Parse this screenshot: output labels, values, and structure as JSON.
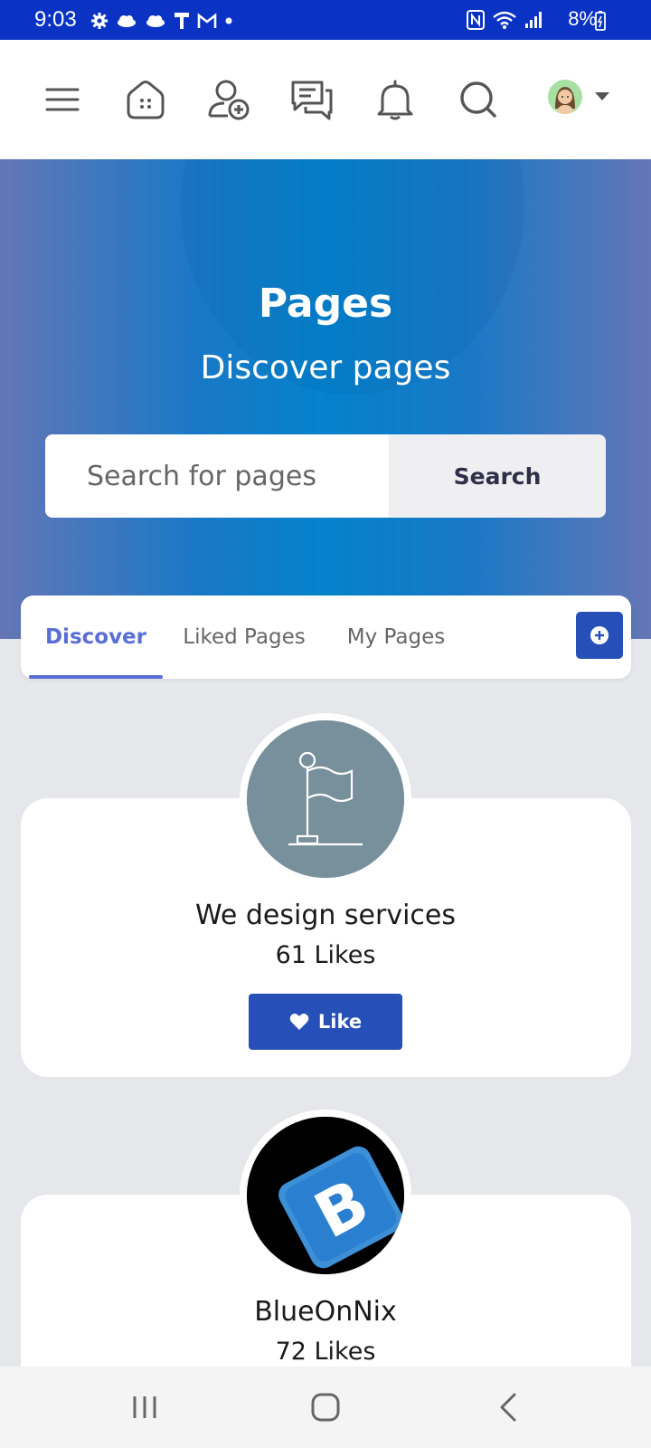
{
  "status_bar": {
    "time": "9:03",
    "battery": "8%",
    "left_icons": [
      "gear-icon",
      "cloud-icon",
      "cloud-icon",
      "hammer-icon",
      "gmail-icon",
      "dot-icon"
    ],
    "right_icons": [
      "nfc-icon",
      "wifi-icon",
      "signal-icon",
      "battery-icon"
    ]
  },
  "header": {
    "icons": [
      "menu-icon",
      "home-icon",
      "add-friend-icon",
      "messages-icon",
      "bell-icon",
      "search-icon"
    ],
    "profile": "avatar"
  },
  "hero": {
    "title": "Pages",
    "subtitle": "Discover pages",
    "search_placeholder": "Search for pages",
    "search_button": "Search"
  },
  "tabs": [
    {
      "label": "Discover",
      "active": true
    },
    {
      "label": "Liked Pages",
      "active": false
    },
    {
      "label": "My Pages",
      "active": false
    }
  ],
  "pages": [
    {
      "name": "We design services",
      "likes": "61 Likes",
      "button": "Like",
      "avatar": "flag-icon"
    },
    {
      "name": "BlueOnNix",
      "likes": "72 Likes",
      "avatar": "blueonnix-logo"
    }
  ],
  "colors": {
    "status_bar": "#0a33c4",
    "accent": "#2650b8",
    "tab_active": "#5a6fd6",
    "hero_center": "#0382cb",
    "hero_edge": "#6476b6",
    "flag_avatar_bg": "#78909c"
  }
}
